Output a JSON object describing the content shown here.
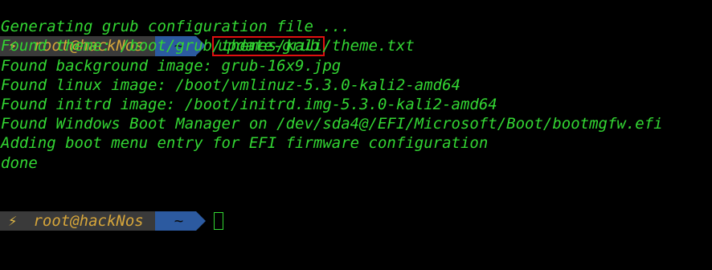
{
  "window": {
    "title": ""
  },
  "prompt": {
    "bolt": "⚡",
    "user_host": "root@hackNos",
    "dir": "~"
  },
  "command": "update-grub",
  "output": [
    "Generating grub configuration file ...",
    "Found theme: /boot/grub/themes/kali/theme.txt",
    "Found background image: grub-16x9.jpg",
    "Found linux image: /boot/vmlinuz-5.3.0-kali2-amd64",
    "Found initrd image: /boot/initrd.img-5.3.0-kali2-amd64",
    "Found Windows Boot Manager on /dev/sda4@/EFI/Microsoft/Boot/bootmgfw.efi",
    "Adding boot menu entry for EFI firmware configuration",
    "done"
  ],
  "colors": {
    "background": "#000000",
    "output_text": "#33d633",
    "prompt_user_bg": "#3a3a3a",
    "prompt_user_fg": "#d7a63a",
    "prompt_dir_bg": "#2c5aa0",
    "highlight_box": "#e01010"
  }
}
